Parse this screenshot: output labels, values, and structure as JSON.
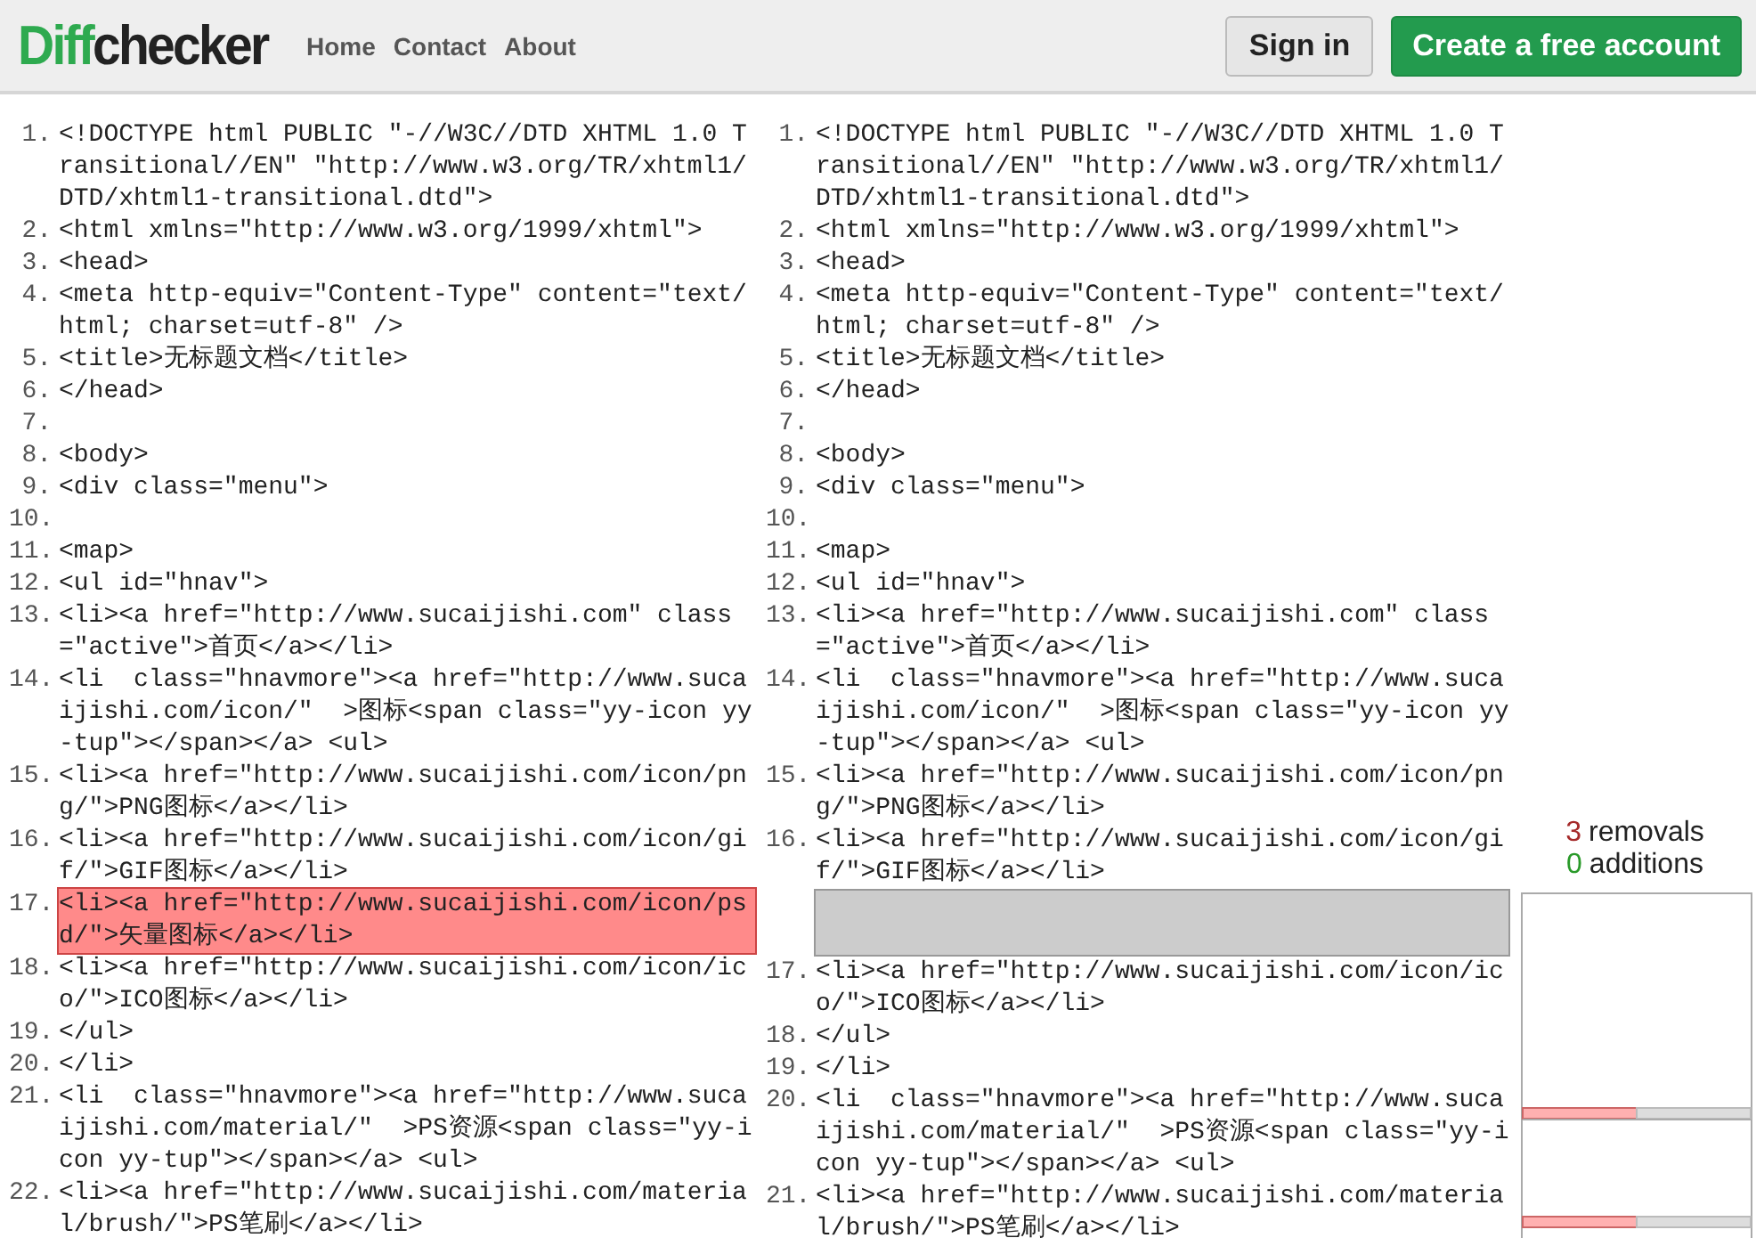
{
  "header": {
    "logo": {
      "accent": "Diff",
      "rest": "checker"
    },
    "nav": [
      "Home",
      "Contact",
      "About"
    ],
    "buttons": [
      {
        "kind": "secondary",
        "label": "Sign in"
      },
      {
        "kind": "primary",
        "label": "Create a free account"
      }
    ]
  },
  "panels": [
    {
      "rows": [
        {
          "kind": "line",
          "num": "1.",
          "text": "<!DOCTYPE html PUBLIC \"-//W3C//DTD XHTML 1.0 Transitional//EN\" \"http://www.w3.org/TR/xhtml1/DTD/xhtml1-transitional.dtd\">"
        },
        {
          "kind": "line",
          "num": "2.",
          "text": "<html xmlns=\"http://www.w3.org/1999/xhtml\">"
        },
        {
          "kind": "line",
          "num": "3.",
          "text": "<head>"
        },
        {
          "kind": "line",
          "num": "4.",
          "text": "<meta http-equiv=\"Content-Type\" content=\"text/html; charset=utf-8\" />"
        },
        {
          "kind": "line",
          "num": "5.",
          "text": "<title>无标题文档</title>"
        },
        {
          "kind": "line",
          "num": "6.",
          "text": "</head>"
        },
        {
          "kind": "line",
          "num": "7."
        },
        {
          "kind": "line",
          "num": "8.",
          "text": "<body>"
        },
        {
          "kind": "line",
          "num": "9.",
          "text": "<div class=\"menu\">"
        },
        {
          "kind": "line",
          "num": "10."
        },
        {
          "kind": "line",
          "num": "11.",
          "text": "<map>"
        },
        {
          "kind": "line",
          "num": "12.",
          "text": "<ul id=\"hnav\">"
        },
        {
          "kind": "line",
          "num": "13.",
          "text": "<li><a href=\"http://www.sucaijishi.com\" class=\"active\">首页</a></li>"
        },
        {
          "kind": "line",
          "num": "14.",
          "text": "<li  class=\"hnavmore\"><a href=\"http://www.sucaijishi.com/icon/\"  >图标<span class=\"yy-icon yy-tup\"></span></a> <ul>"
        },
        {
          "kind": "line",
          "num": "15.",
          "text": "<li><a href=\"http://www.sucaijishi.com/icon/png/\">PNG图标</a></li>"
        },
        {
          "kind": "line",
          "num": "16.",
          "text": "<li><a href=\"http://www.sucaijishi.com/icon/gif/\">GIF图标</a></li>"
        },
        {
          "kind": "removed",
          "num": "17.",
          "text": "<li><a href=\"http://www.sucaijishi.com/icon/psd/\">矢量图标</a></li>"
        },
        {
          "kind": "line",
          "num": "18.",
          "text": "<li><a href=\"http://www.sucaijishi.com/icon/ico/\">ICO图标</a></li>"
        },
        {
          "kind": "line",
          "num": "19.",
          "text": "</ul>"
        },
        {
          "kind": "line",
          "num": "20.",
          "text": "</li>"
        },
        {
          "kind": "line",
          "num": "21.",
          "text": "<li  class=\"hnavmore\"><a href=\"http://www.sucaijishi.com/material/\"  >PS资源<span class=\"yy-icon yy-tup\"></span></a> <ul>"
        },
        {
          "kind": "line",
          "num": "22.",
          "text": "<li><a href=\"http://www.sucaijishi.com/material/brush/\">PS笔刷</a></li>"
        }
      ]
    },
    {
      "rows": [
        {
          "kind": "line",
          "num": "1.",
          "text": "<!DOCTYPE html PUBLIC \"-//W3C//DTD XHTML 1.0 Transitional//EN\" \"http://www.w3.org/TR/xhtml1/DTD/xhtml1-transitional.dtd\">"
        },
        {
          "kind": "line",
          "num": "2.",
          "text": "<html xmlns=\"http://www.w3.org/1999/xhtml\">"
        },
        {
          "kind": "line",
          "num": "3.",
          "text": "<head>"
        },
        {
          "kind": "line",
          "num": "4.",
          "text": "<meta http-equiv=\"Content-Type\" content=\"text/html; charset=utf-8\" />"
        },
        {
          "kind": "line",
          "num": "5.",
          "text": "<title>无标题文档</title>"
        },
        {
          "kind": "line",
          "num": "6.",
          "text": "</head>"
        },
        {
          "kind": "line",
          "num": "7."
        },
        {
          "kind": "line",
          "num": "8.",
          "text": "<body>"
        },
        {
          "kind": "line",
          "num": "9.",
          "text": "<div class=\"menu\">"
        },
        {
          "kind": "line",
          "num": "10."
        },
        {
          "kind": "line",
          "num": "11.",
          "text": "<map>"
        },
        {
          "kind": "line",
          "num": "12.",
          "text": "<ul id=\"hnav\">"
        },
        {
          "kind": "line",
          "num": "13.",
          "text": "<li><a href=\"http://www.sucaijishi.com\" class=\"active\">首页</a></li>"
        },
        {
          "kind": "line",
          "num": "14.",
          "text": "<li  class=\"hnavmore\"><a href=\"http://www.sucaijishi.com/icon/\"  >图标<span class=\"yy-icon yy-tup\"></span></a> <ul>"
        },
        {
          "kind": "line",
          "num": "15.",
          "text": "<li><a href=\"http://www.sucaijishi.com/icon/png/\">PNG图标</a></li>"
        },
        {
          "kind": "line",
          "num": "16.",
          "text": "<li><a href=\"http://www.sucaijishi.com/icon/gif/\">GIF图标</a></li>"
        },
        {
          "kind": "placeholder"
        },
        {
          "kind": "line",
          "num": "17.",
          "text": "<li><a href=\"http://www.sucaijishi.com/icon/ico/\">ICO图标</a></li>"
        },
        {
          "kind": "line",
          "num": "18.",
          "text": "</ul>"
        },
        {
          "kind": "line",
          "num": "19.",
          "text": "</li>"
        },
        {
          "kind": "line",
          "num": "20.",
          "text": "<li  class=\"hnavmore\"><a href=\"http://www.sucaijishi.com/material/\"  >PS资源<span class=\"yy-icon yy-tup\"></span></a> <ul>"
        },
        {
          "kind": "line",
          "num": "21.",
          "text": "<li><a href=\"http://www.sucaijishi.com/material/brush/\">PS笔刷</a></li>"
        }
      ]
    }
  ],
  "summary": {
    "removals": {
      "count": "3",
      "label": "removals"
    },
    "additions": {
      "count": "0",
      "label": "additions"
    }
  }
}
